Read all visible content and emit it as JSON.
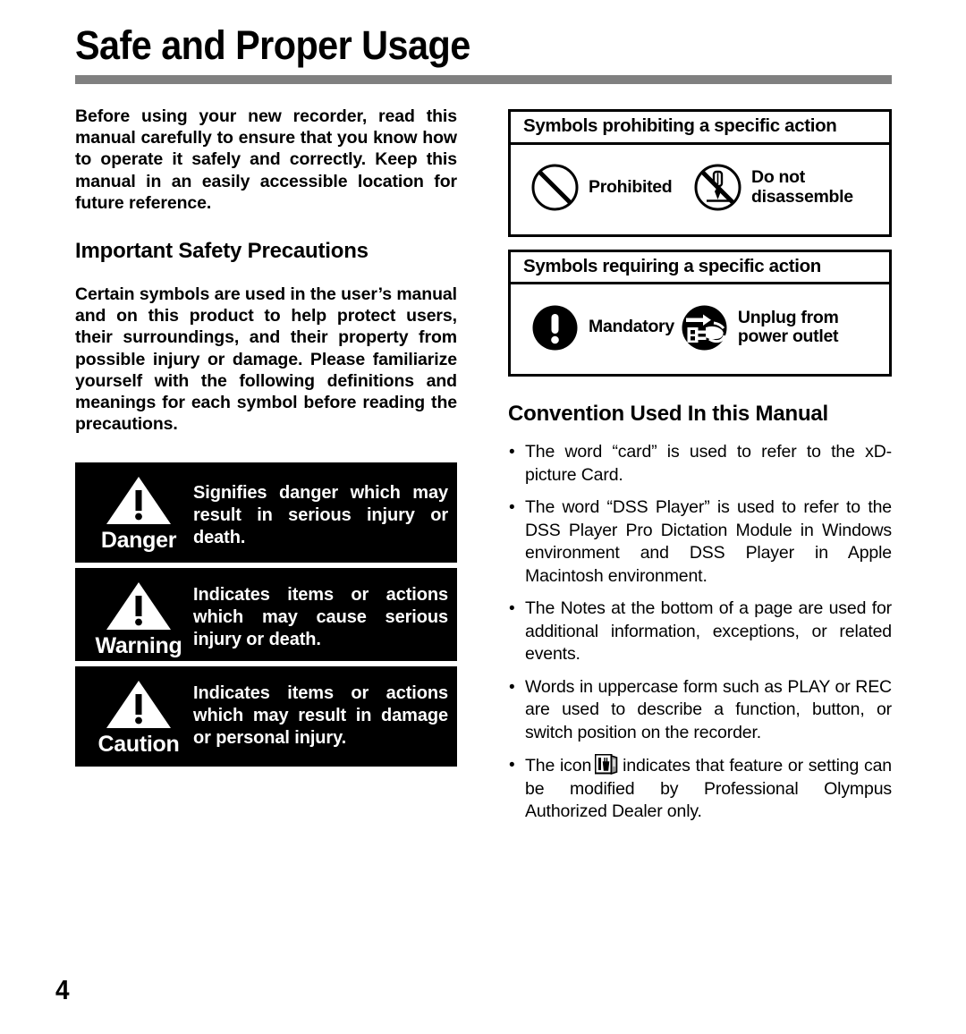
{
  "page": {
    "title": "Safe and Proper Usage",
    "page_number": "4",
    "rule_color": "#808080"
  },
  "left_column": {
    "intro_paragraph": "Before using your new recorder, read this manual carefully to ensure that you know how to operate it safely and correctly. Keep this manual in an easily accessible location for future reference.",
    "heading_important": "Important Safety Precautions",
    "precautions_paragraph": "Certain symbols are used in the user’s manual and on this product to help protect users, their surroundings, and their property from possible injury or damage. Please familiarize yourself with the following definitions and meanings for each symbol before reading the precautions.",
    "warning_boxes": [
      {
        "label": "Danger",
        "icon": "warning-triangle-icon",
        "text": "Signifies danger which may result in serious injury or death."
      },
      {
        "label": "Warning",
        "icon": "warning-triangle-icon",
        "text": "Indicates items or actions which may cause serious injury or death."
      },
      {
        "label": "Caution",
        "icon": "warning-triangle-icon",
        "text": "Indicates items or actions which may result in damage or personal injury."
      }
    ]
  },
  "right_column": {
    "symbol_boxes": [
      {
        "header": "Symbols prohibiting a specific action",
        "items": [
          {
            "icon": "prohibited-circle-slash-icon",
            "label": "Prohibited"
          },
          {
            "icon": "do-not-disassemble-icon",
            "label": "Do not disassemble"
          }
        ]
      },
      {
        "header": "Symbols requiring a specific action",
        "items": [
          {
            "icon": "mandatory-exclamation-icon",
            "label": "Mandatory"
          },
          {
            "icon": "unplug-power-outlet-icon",
            "label": "Unplug from power outlet"
          }
        ]
      }
    ],
    "heading_convention": "Convention Used In this Manual",
    "bullets": [
      "The word “card” is used to refer to the xD-picture Card.",
      "The word “DSS Player” is used to refer to the DSS Player Pro Dictation Module in Windows environment and DSS Player in Apple Macintosh environment.",
      "The Notes at the bottom of a page are used for additional information, exceptions, or related events.",
      "Words in uppercase form such as PLAY or REC are used to describe a function, button, or switch position on the recorder."
    ],
    "last_bullet": {
      "before_icon": "The icon",
      "icon": "professional-tools-icon",
      "after_icon": "indicates that feature or setting can be modified by Professional Olympus Authorized Dealer only."
    }
  }
}
